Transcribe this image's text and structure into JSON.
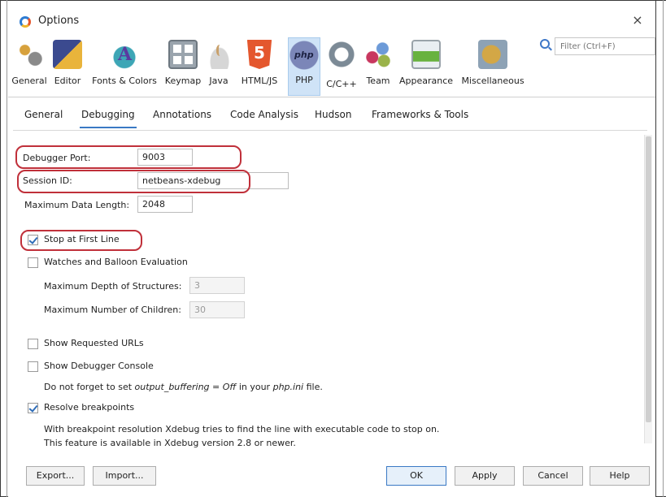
{
  "window": {
    "title": "Options",
    "close_glyph": "×"
  },
  "categories": [
    {
      "label": "General",
      "icon": "general-icon"
    },
    {
      "label": "Editor",
      "icon": "editor-icon"
    },
    {
      "label": "Fonts & Colors",
      "icon": "fonts-colors-icon"
    },
    {
      "label": "Keymap",
      "icon": "keymap-icon"
    },
    {
      "label": "Java",
      "icon": "java-icon"
    },
    {
      "label": "HTML/JS",
      "icon": "html5-icon"
    },
    {
      "label": "PHP",
      "icon": "php-icon",
      "selected": true
    },
    {
      "label": "C/C++",
      "icon": "cpp-icon"
    },
    {
      "label": "Team",
      "icon": "team-icon"
    },
    {
      "label": "Appearance",
      "icon": "appearance-icon"
    },
    {
      "label": "Miscellaneous",
      "icon": "miscellaneous-icon"
    }
  ],
  "filter": {
    "placeholder": "Filter (Ctrl+F)"
  },
  "tabs": [
    {
      "label": "General"
    },
    {
      "label": "Debugging",
      "selected": true
    },
    {
      "label": "Annotations"
    },
    {
      "label": "Code Analysis"
    },
    {
      "label": "Hudson"
    },
    {
      "label": "Frameworks & Tools"
    }
  ],
  "debugging": {
    "debugger_port": {
      "label": "Debugger Port:",
      "value": "9003"
    },
    "session_id": {
      "label": "Session ID:",
      "value": "netbeans-xdebug"
    },
    "max_data_length": {
      "label": "Maximum Data Length:",
      "value": "2048"
    },
    "stop_at_first_line": {
      "label": "Stop at First Line",
      "checked": true
    },
    "watches_balloon": {
      "label": "Watches and Balloon Evaluation",
      "checked": false
    },
    "max_depth": {
      "label": "Maximum Depth of Structures:",
      "value": "3"
    },
    "max_children": {
      "label": "Maximum Number of Children:",
      "value": "30"
    },
    "show_requested_urls": {
      "label": "Show Requested URLs",
      "checked": false
    },
    "show_debugger_console": {
      "label": "Show Debugger Console",
      "checked": false
    },
    "output_buffering_note": {
      "prefix": "Do not forget to set ",
      "setting": "output_buffering = Off",
      "middle": " in your ",
      "file": "php.ini",
      "suffix": " file."
    },
    "resolve_breakpoints": {
      "label": "Resolve breakpoints",
      "checked": true
    },
    "resolution_note_1": "With breakpoint resolution Xdebug tries to find the line with executable code to stop on.",
    "resolution_note_2": "This feature is available in Xdebug version 2.8 or newer."
  },
  "footer": {
    "export": "Export...",
    "import": "Import...",
    "ok": "OK",
    "apply": "Apply",
    "cancel": "Cancel",
    "help": "Help"
  },
  "colors": {
    "highlight": "#c0303a",
    "accent": "#3a79c4",
    "selected_category": "#cfe3f7"
  }
}
